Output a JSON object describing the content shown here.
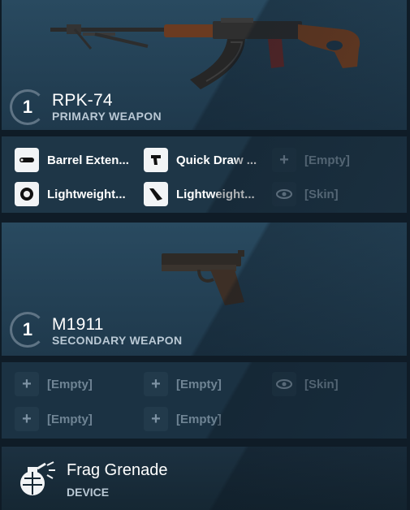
{
  "primary": {
    "count": "1",
    "name": "RPK-74",
    "type": "PRIMARY WEAPON",
    "icon": "rifle-icon",
    "attachments": [
      {
        "label": "Barrel Exten...",
        "icon": "barrel-extension-icon",
        "empty": false
      },
      {
        "label": "Quick Draw ...",
        "icon": "grip-icon",
        "empty": false
      },
      {
        "label": "[Empty]",
        "icon": "plus-icon",
        "empty": true
      },
      {
        "label": "Lightweight...",
        "icon": "target-ring-icon",
        "empty": false
      },
      {
        "label": "Lightweight...",
        "icon": "stock-icon",
        "empty": false
      },
      {
        "label": "[Skin]",
        "icon": "eye-icon",
        "empty": true
      }
    ]
  },
  "secondary": {
    "count": "1",
    "name": "M1911",
    "type": "SECONDARY WEAPON",
    "icon": "pistol-icon",
    "attachments": [
      {
        "label": "[Empty]",
        "icon": "plus-icon",
        "empty": true
      },
      {
        "label": "[Empty]",
        "icon": "plus-icon",
        "empty": true
      },
      {
        "label": "[Skin]",
        "icon": "eye-icon",
        "empty": true
      },
      {
        "label": "[Empty]",
        "icon": "plus-icon",
        "empty": true
      },
      {
        "label": "[Empty]",
        "icon": "plus-icon",
        "empty": true
      }
    ]
  },
  "device": {
    "name": "Frag Grenade",
    "type": "DEVICE",
    "icon": "grenade-icon"
  }
}
